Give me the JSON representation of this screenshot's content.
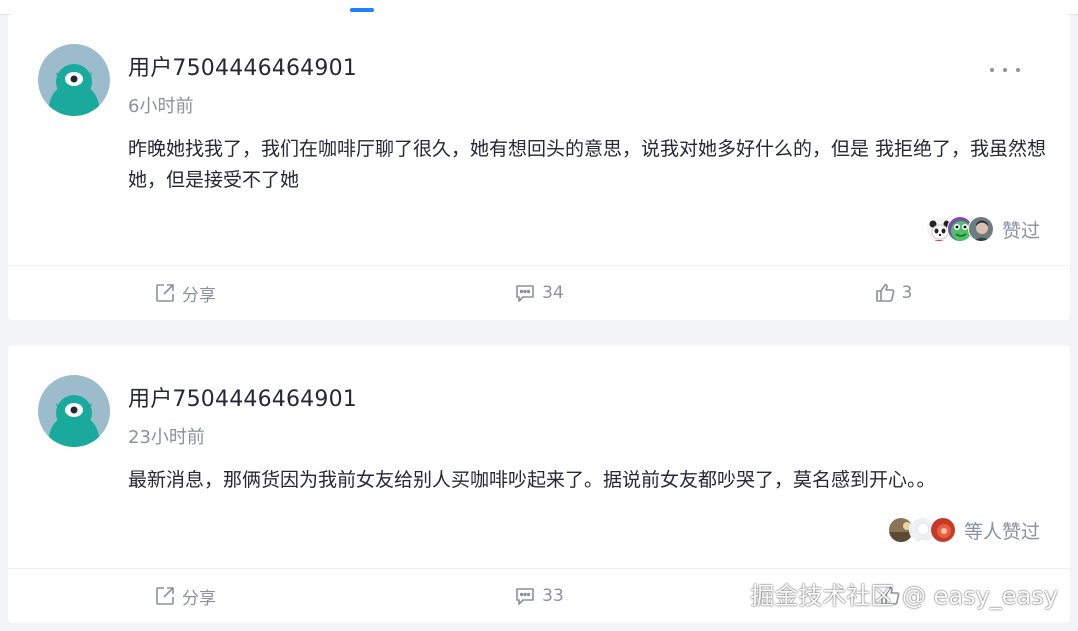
{
  "colors": {
    "page_bg": "#f2f3f5",
    "card_bg": "#ffffff",
    "accent": "#1e80ff",
    "text_primary": "#252933",
    "text_secondary": "#8a919f",
    "avatar_bg": "#9cbccb",
    "avatar_body": "#1aa99d"
  },
  "comments": [
    {
      "avatar_icon": "teal-monster-avatar-icon",
      "username": "用户7504446464901",
      "time": "6小时前",
      "more_icon": "ellipsis-icon",
      "text": "昨晚她找我了，我们在咖啡厅聊了很久，她有想回头的意思，说我对她多好什么的，但是 我拒绝了，我虽然想她，但是接受不了她",
      "likers_text": "赞过",
      "liker_icons": [
        "panda-avatar-icon",
        "frog-avatar-icon",
        "portrait-avatar-icon"
      ],
      "actions": {
        "share": "分享",
        "comments": "34",
        "likes": "3"
      }
    },
    {
      "avatar_icon": "teal-monster-avatar-icon",
      "username": "用户7504446464901",
      "time": "23小时前",
      "more_icon": "ellipsis-icon",
      "text": "最新消息，那俩货因为我前女友给别人买咖啡吵起来了。据说前女友都吵哭了，莫名感到开心。。",
      "likers_text": "等人赞过",
      "liker_icons": [
        "landscape-avatar-icon",
        "white-avatar-icon",
        "red-avatar-icon"
      ],
      "actions": {
        "share": "分享",
        "comments": "33",
        "likes": ""
      }
    }
  ],
  "watermark": "掘金技术社区 @ easy_easy"
}
